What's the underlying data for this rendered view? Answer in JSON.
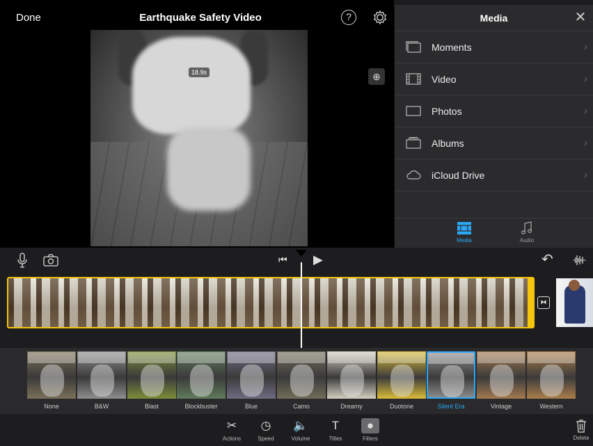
{
  "header": {
    "done_label": "Done",
    "title": "Earthquake Safety Video",
    "help_glyph": "?",
    "settings_icon": "gear-icon"
  },
  "viewer": {
    "time_badge": "18.9s",
    "zoom_icon": "zoom-in-icon"
  },
  "media_panel": {
    "title": "Media",
    "close_glyph": "✕",
    "rows": [
      {
        "label": "Moments",
        "icon": "moments-icon"
      },
      {
        "label": "Video",
        "icon": "film-icon"
      },
      {
        "label": "Photos",
        "icon": "photo-frame-icon"
      },
      {
        "label": "Albums",
        "icon": "albums-icon"
      },
      {
        "label": "iCloud Drive",
        "icon": "cloud-icon"
      }
    ],
    "tabs": [
      {
        "label": "Media",
        "icon": "media-grid-icon",
        "active": true
      },
      {
        "label": "Audio",
        "icon": "music-note-icon",
        "active": false
      }
    ]
  },
  "controls": {
    "mic_icon": "microphone-icon",
    "camera_icon": "camera-icon",
    "skip_back_glyph": "⏮",
    "play_glyph": "▶",
    "undo_glyph": "↶",
    "waveform_icon": "waveform-icon"
  },
  "filters": [
    {
      "label": "None",
      "tint": "#7a6f58"
    },
    {
      "label": "B&W",
      "tint": "#8c8c8c"
    },
    {
      "label": "Blast",
      "tint": "#7a8c3a"
    },
    {
      "label": "Blockbuster",
      "tint": "#5f7a5a"
    },
    {
      "label": "Blue",
      "tint": "#6e6a80"
    },
    {
      "label": "Camo",
      "tint": "#706b58"
    },
    {
      "label": "Dreamy",
      "tint": "#cfcbbd"
    },
    {
      "label": "Duotone",
      "tint": "#d6b83a"
    },
    {
      "label": "Silent Era",
      "tint": "#8a8a8a",
      "selected": true
    },
    {
      "label": "Vintage",
      "tint": "#a07850"
    },
    {
      "label": "Western",
      "tint": "#a87c4a"
    }
  ],
  "toolbar": {
    "tools": [
      {
        "label": "Actions",
        "glyph": "✂"
      },
      {
        "label": "Speed",
        "glyph": "◷"
      },
      {
        "label": "Volume",
        "glyph": "🔈"
      },
      {
        "label": "Titles",
        "glyph": "T"
      },
      {
        "label": "Filters",
        "glyph": "●",
        "active": true
      }
    ],
    "delete_label": "Delete",
    "delete_icon": "trash-icon"
  }
}
